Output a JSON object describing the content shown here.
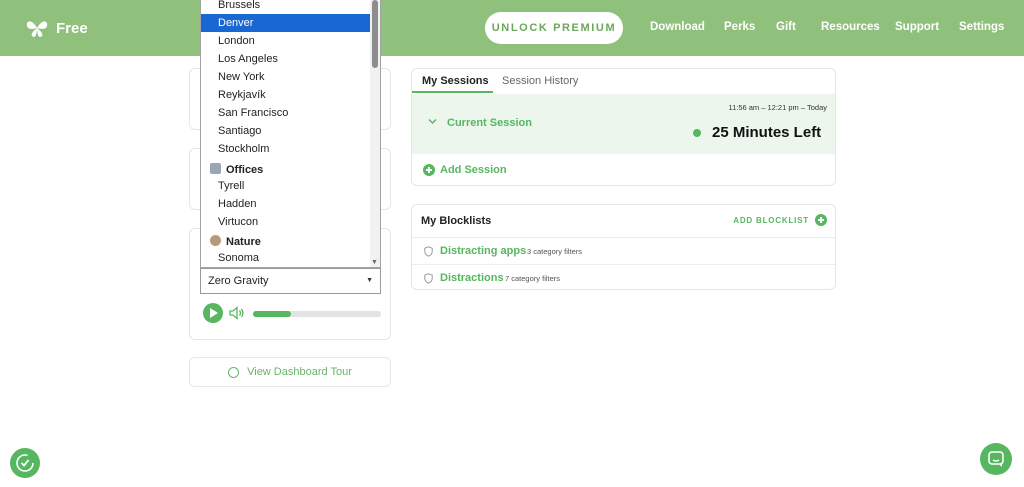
{
  "header": {
    "brand": "Free",
    "premium_label": "UNLOCK PREMIUM",
    "nav": [
      "Download",
      "Perks",
      "Gift",
      "Resources",
      "Support",
      "Settings"
    ]
  },
  "dropdown": {
    "cities": [
      "Brussels",
      "Denver",
      "London",
      "Los Angeles",
      "New York",
      "Reykjavík",
      "San Francisco",
      "Santiago",
      "Stockholm"
    ],
    "selected": "Denver",
    "groups": [
      {
        "label": "Offices",
        "items": [
          "Tyrell",
          "Hadden",
          "Virtucon"
        ]
      },
      {
        "label": "Nature",
        "items": [
          "Sonoma"
        ]
      }
    ]
  },
  "sound": {
    "selected_value": "Zero Gravity",
    "volume_percent": 30
  },
  "tour_label": "View Dashboard Tour",
  "sessions": {
    "tabs": [
      "My Sessions",
      "Session History"
    ],
    "current_label": "Current Session",
    "time_range": "11:56 am – 12:21 pm – Today",
    "remaining": "25 Minutes Left",
    "add_label": "Add Session"
  },
  "blocklists": {
    "title": "My Blocklists",
    "add_label": "ADD BLOCKLIST",
    "items": [
      {
        "name": "Distracting apps",
        "count": "3 category filters"
      },
      {
        "name": "Distractions",
        "count": "7 category filters"
      }
    ]
  },
  "colors": {
    "brand_green": "#8fc07c",
    "accent_green": "#56b760",
    "selected_blue": "#1967d2"
  }
}
